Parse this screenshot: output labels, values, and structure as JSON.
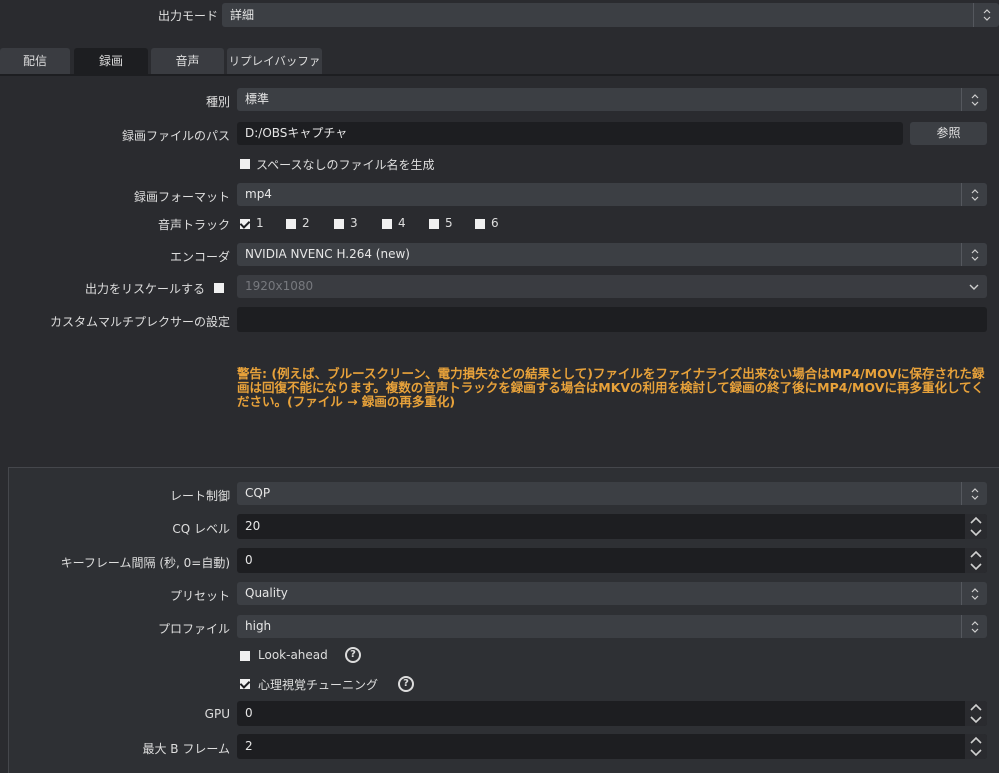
{
  "output_mode": {
    "label": "出力モード",
    "value": "詳細"
  },
  "tabs": [
    {
      "label": "配信"
    },
    {
      "label": "録画"
    },
    {
      "label": "音声"
    },
    {
      "label": "リプレイバッファ"
    }
  ],
  "recording": {
    "type": {
      "label": "種別",
      "value": "標準"
    },
    "path": {
      "label": "録画ファイルのパス",
      "value": "D:/OBSキャプチャ",
      "browse": "参照"
    },
    "no_space": {
      "label": "スペースなしのファイル名を生成",
      "checked": false
    },
    "format": {
      "label": "録画フォーマット",
      "value": "mp4"
    },
    "audio_track": {
      "label": "音声トラック",
      "tracks": [
        {
          "label": "1",
          "checked": true
        },
        {
          "label": "2",
          "checked": false
        },
        {
          "label": "3",
          "checked": false
        },
        {
          "label": "4",
          "checked": false
        },
        {
          "label": "5",
          "checked": false
        },
        {
          "label": "6",
          "checked": false
        }
      ]
    },
    "encoder": {
      "label": "エンコーダ",
      "value": "NVIDIA NVENC H.264 (new)"
    },
    "rescale": {
      "label": "出力をリスケールする",
      "checked": false,
      "value": "1920x1080"
    },
    "muxer": {
      "label": "カスタムマルチプレクサーの設定",
      "value": ""
    },
    "warning": "警告: (例えば、ブルースクリーン、電力損失などの結果として)ファイルをファイナライズ出来ない場合はMP4/MOVに保存された録画は回復不能になります。複数の音声トラックを録画する場合はMKVの利用を検討して録画の終了後にMP4/MOVに再多重化してください。(ファイル → 録画の再多重化)"
  },
  "encoder_settings": {
    "rate_control": {
      "label": "レート制御",
      "value": "CQP"
    },
    "cq_level": {
      "label": "CQ レベル",
      "value": "20"
    },
    "keyframe": {
      "label": "キーフレーム間隔 (秒, 0=自動)",
      "value": "0"
    },
    "preset": {
      "label": "プリセット",
      "value": "Quality"
    },
    "profile": {
      "label": "プロファイル",
      "value": "high"
    },
    "lookahead": {
      "label": "Look-ahead",
      "checked": false
    },
    "psycho": {
      "label": "心理視覚チューニング",
      "checked": true
    },
    "gpu": {
      "label": "GPU",
      "value": "0"
    },
    "max_b": {
      "label": "最大 B フレーム",
      "value": "2"
    }
  }
}
